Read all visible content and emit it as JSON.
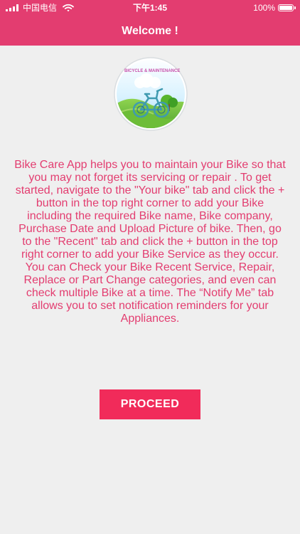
{
  "status_bar": {
    "carrier": "中国电信",
    "time": "下午1:45",
    "battery": "100%",
    "icons": {
      "signal": "signal-bars-icon",
      "wifi": "wifi-icon",
      "battery": "battery-full-icon"
    }
  },
  "header": {
    "title": "Welcome !",
    "color": "#e33d70"
  },
  "logo": {
    "caption": "BICYCLE & MAINTENANCE",
    "icon": "bicycle-landscape-icon"
  },
  "content": {
    "description": "Bike Care App helps you to maintain your Bike so that you may not forget its servicing or repair . To get started, navigate to the \"Your bike\" tab and click the + button in the top right corner to add your Bike including the required  Bike name, Bike company, Purchase Date and Upload Picture of bike. Then, go to the \"Recent\" tab and click the + button in the top right corner to add your Bike Service as they occur.  You can Check your  Bike Recent Service, Repair, Replace or Part Change categories, and even can check multiple Bike at a time. The “Notify Me” tab allows you to set notification reminders for your Appliances.",
    "text_color": "#e33d70"
  },
  "button": {
    "proceed_label": "PROCEED",
    "color": "#f12b5a"
  },
  "theme": {
    "background": "#efefef"
  }
}
